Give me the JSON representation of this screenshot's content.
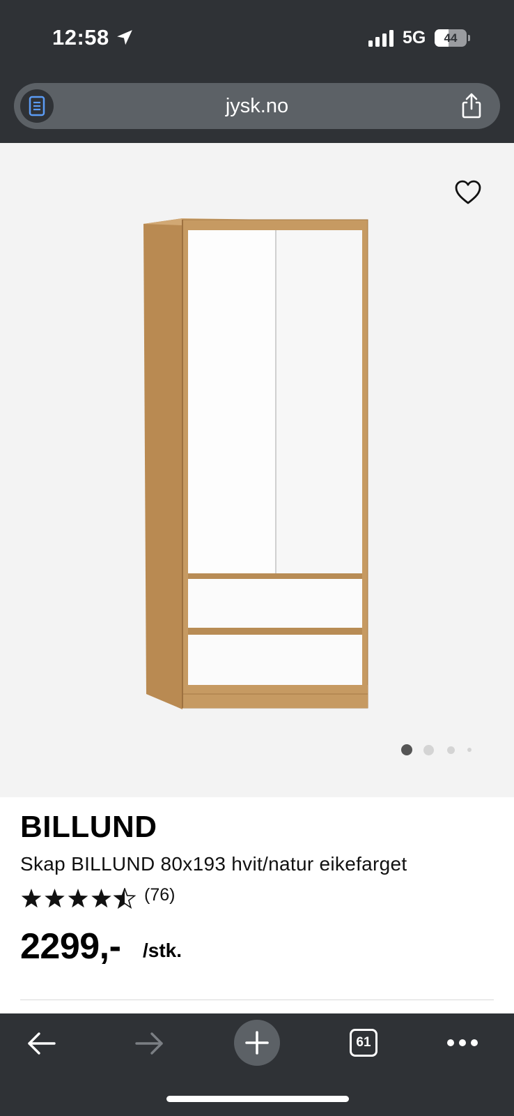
{
  "status_bar": {
    "time": "12:58",
    "network": "5G",
    "battery_level": "44",
    "icons": [
      "location-arrow-icon",
      "signal-bars-icon",
      "battery-icon"
    ]
  },
  "browser": {
    "url": "jysk.no",
    "icons": [
      "reader-mode-icon",
      "share-icon"
    ]
  },
  "gallery": {
    "image_count": 4,
    "active_index": 0,
    "icons": [
      "heart-icon"
    ]
  },
  "product": {
    "brand": "BILLUND",
    "name": "Skap BILLUND 80x193 hvit/natur eikefarget",
    "rating": 4.5,
    "rating_max": 5,
    "review_count": "(76)",
    "price": "2299,-",
    "unit": "/stk."
  },
  "toolbar": {
    "tab_count": "61",
    "icons": [
      "back-arrow-icon",
      "forward-arrow-icon",
      "plus-icon",
      "tabs-icon",
      "more-icon"
    ]
  },
  "colors": {
    "chrome": "#2f3236",
    "url_bar": "#5c6166",
    "gallery_bg": "#f3f3f3",
    "oak": "#c69a62",
    "reader_icon": "#5b9cf5"
  }
}
